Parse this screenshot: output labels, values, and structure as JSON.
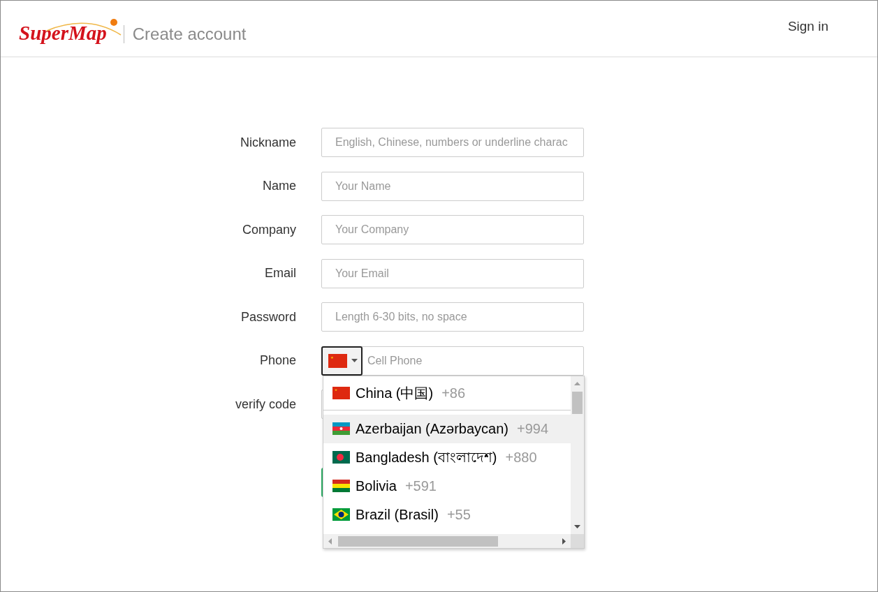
{
  "header": {
    "logo": "SuperMap",
    "page_title": "Create account",
    "sign_in": "Sign in"
  },
  "fields": [
    {
      "kind": "text",
      "label": "Nickname",
      "placeholder": "English, Chinese, numbers or underline charac"
    },
    {
      "kind": "text",
      "label": "Name",
      "placeholder": "Your Name"
    },
    {
      "kind": "text",
      "label": "Company",
      "placeholder": "Your Company"
    },
    {
      "kind": "text",
      "label": "Email",
      "placeholder": "Your Email"
    },
    {
      "kind": "text",
      "label": "Password",
      "placeholder": "Length 6-30 bits, no space"
    },
    {
      "kind": "phone",
      "label": "Phone",
      "placeholder": "Cell Phone",
      "country_button": {
        "kind": "cn"
      }
    },
    {
      "kind": "code",
      "label": "verify code"
    }
  ],
  "country_dropdown": {
    "expanded": true,
    "preferred": [
      {
        "kind": "cn",
        "name": "China (中国)",
        "dial_code": "+86",
        "highlighted": false
      }
    ],
    "countries": [
      {
        "kind": "az",
        "name": "Azerbaijan (Azərbaycan)",
        "dial_code": "+994",
        "highlighted": true
      },
      {
        "kind": "bd",
        "name": "Bangladesh (বাংলাদেশ)",
        "dial_code": "+880",
        "highlighted": false
      },
      {
        "kind": "bo",
        "name": "Bolivia",
        "dial_code": "+591",
        "highlighted": false
      },
      {
        "kind": "br",
        "name": "Brazil (Brasil)",
        "dial_code": "+55",
        "highlighted": false
      }
    ]
  }
}
